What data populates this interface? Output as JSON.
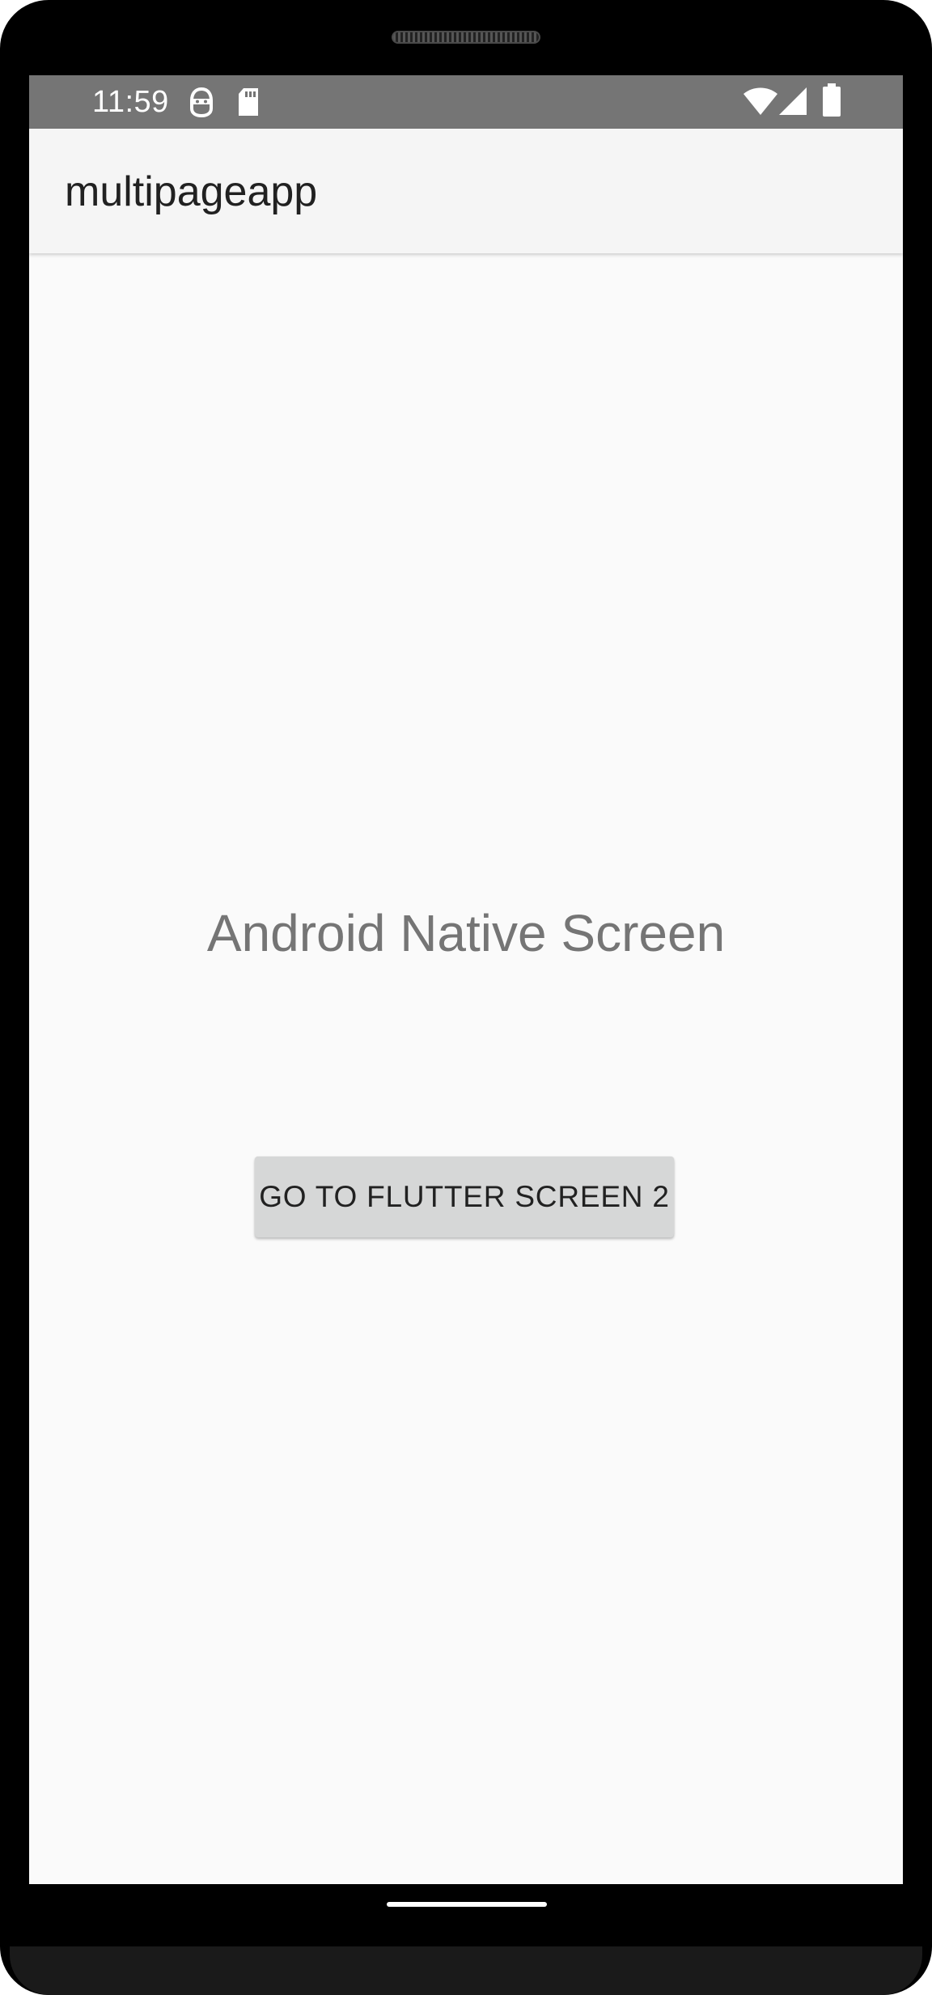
{
  "status_bar": {
    "time": "11:59",
    "left_icons": [
      "ninja-icon",
      "sd-card-icon"
    ],
    "right_icons": [
      "wifi-icon",
      "cell-signal-icon",
      "battery-icon"
    ]
  },
  "app_bar": {
    "title": "multipageapp"
  },
  "main": {
    "headline": "Android Native Screen",
    "button_label": "GO TO FLUTTER SCREEN 2"
  },
  "colors": {
    "status_bar": "#757575",
    "app_bar": "#f5f5f5",
    "background": "#fafafa",
    "button": "#d6d7d7",
    "headline_text": "#757575",
    "frame": "#000000"
  }
}
